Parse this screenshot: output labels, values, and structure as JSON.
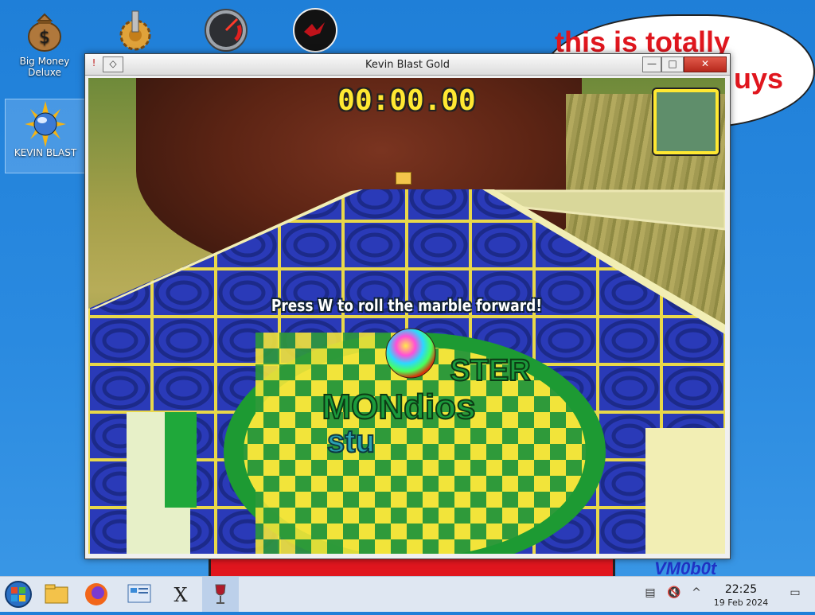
{
  "desktop": {
    "icons": [
      {
        "label_line1": "Big Money",
        "label_line2": "Deluxe",
        "icon": "money-bag-icon"
      },
      {
        "label_line1": "",
        "label_line2": "",
        "icon": "gear-icon"
      },
      {
        "label_line1": "",
        "label_line2": "",
        "icon": "gauge-icon"
      },
      {
        "label_line1": "",
        "label_line2": "",
        "icon": "red-swirl-icon"
      },
      {
        "label_line1": "KEVIN BLAST",
        "label_line2": "",
        "icon": "kevin-blast-icon"
      }
    ],
    "bubble_line1": "this is totally",
    "bubble_line2": "uys",
    "wall_text": "VM0b0t"
  },
  "window": {
    "title": "Kevin Blast Gold",
    "pin_glyph": "!",
    "keep_glyph": "◇",
    "min_glyph": "—",
    "max_glyph": "□",
    "close_glyph": "✕"
  },
  "game": {
    "timer": "00:00.00",
    "hint": "Press W to roll the marble forward!",
    "logo_line1": "MONdios",
    "logo_line2": "stu",
    "logo_line3": "STER"
  },
  "taskbar": {
    "apps": [
      {
        "icon": "start-orb-icon"
      },
      {
        "icon": "file-explorer-icon"
      },
      {
        "icon": "firefox-icon"
      },
      {
        "icon": "control-panel-icon"
      },
      {
        "icon": "x-app-icon"
      },
      {
        "icon": "wine-glass-icon"
      }
    ],
    "clock_time": "22:25",
    "clock_date": "19 Feb 2024",
    "colors": {
      "accent": "#bcd0ea",
      "bar": "#dfe7f2"
    }
  }
}
